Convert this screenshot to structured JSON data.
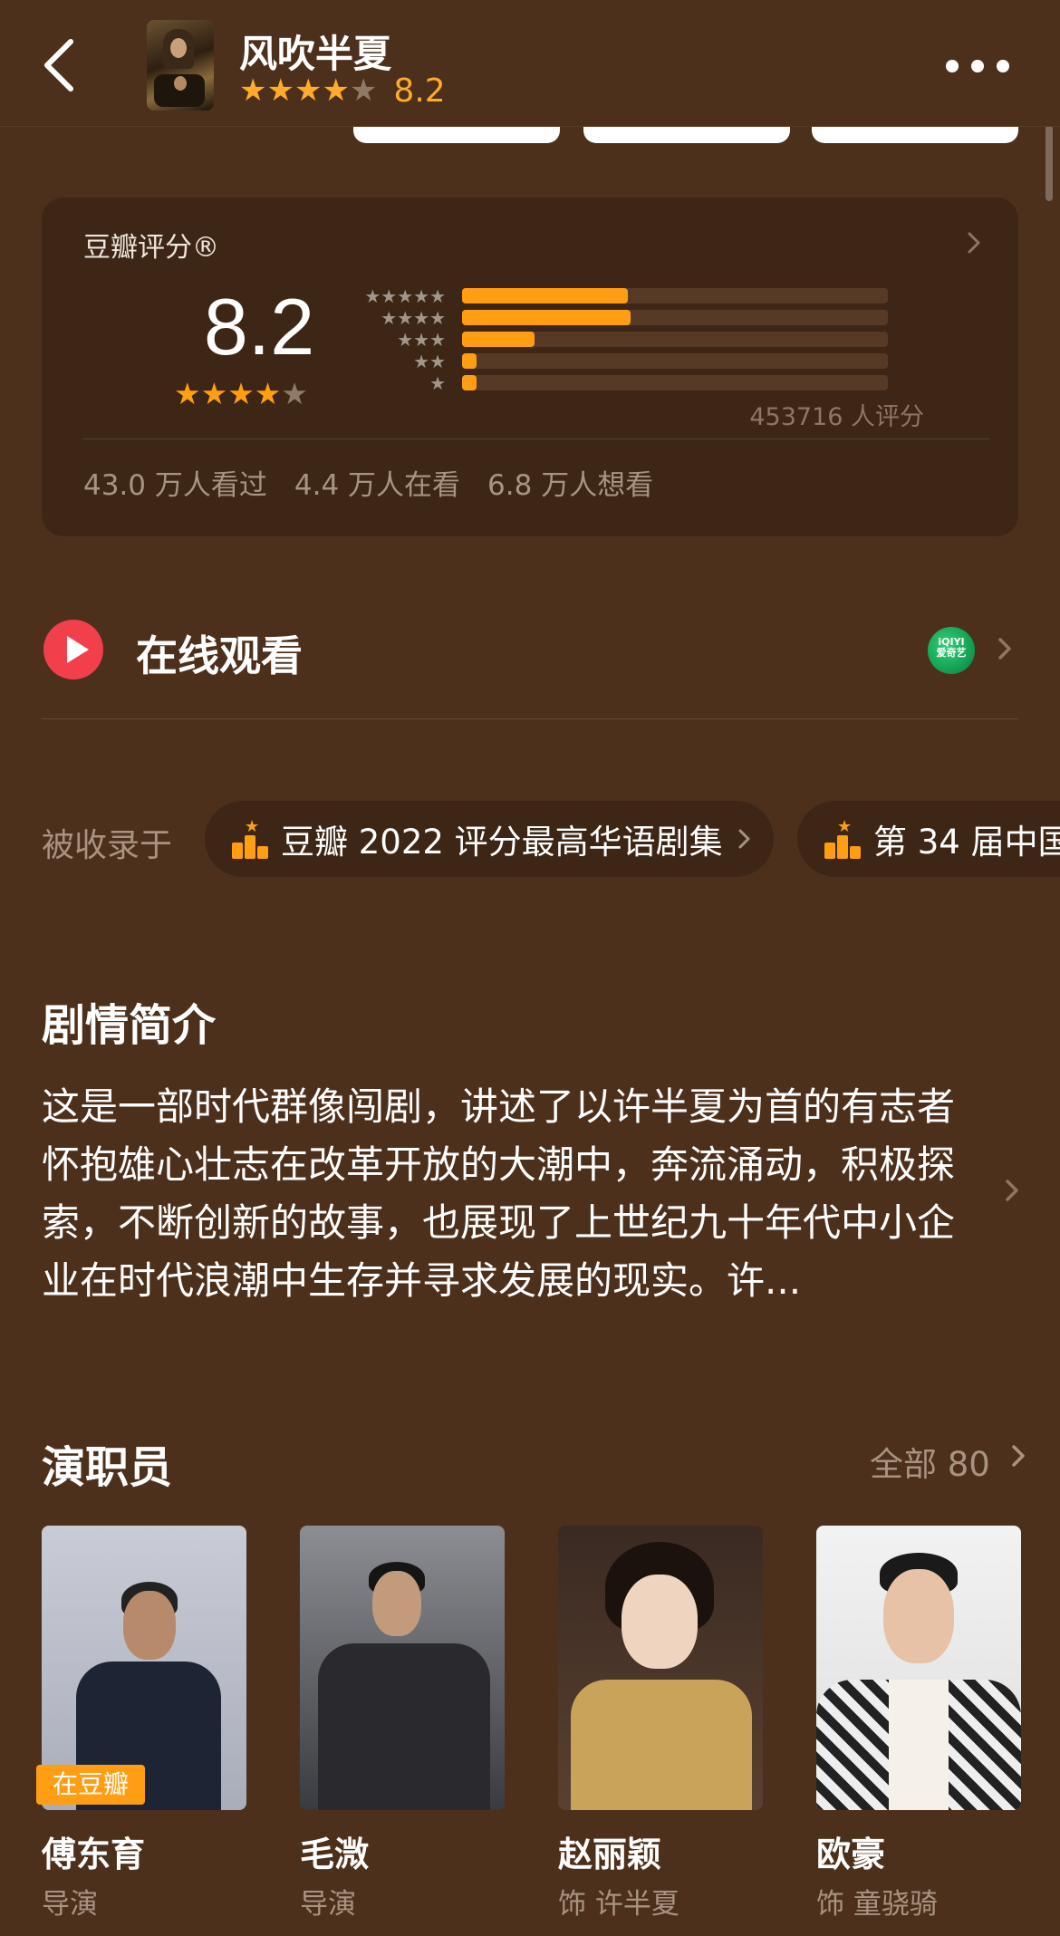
{
  "header": {
    "title": "风吹半夏",
    "score": "8.2",
    "star_rating": 4
  },
  "rating_card": {
    "title": "豆瓣评分®",
    "score": "8.2",
    "star_rating": 4,
    "distribution": [
      {
        "stars": 5,
        "fraction": 0.39
      },
      {
        "stars": 4,
        "fraction": 0.395
      },
      {
        "stars": 3,
        "fraction": 0.17
      },
      {
        "stars": 2,
        "fraction": 0.035
      },
      {
        "stars": 1,
        "fraction": 0.035
      }
    ],
    "count_text": "453716 人评分",
    "stats": [
      "43.0 万人看过",
      "4.4 万人在看",
      "6.8 万人想看"
    ]
  },
  "watch": {
    "label": "在线观看",
    "provider_icon_text": "iQIYI\n爱奇艺",
    "provider_icon": "iqiyi-icon"
  },
  "collections": {
    "label": "被收录于",
    "chips": [
      {
        "text": "豆瓣 2022 评分最高华语剧集"
      },
      {
        "text": "第 34 届中国"
      }
    ]
  },
  "synopsis": {
    "title": "剧情简介",
    "text": "这是一部时代群像闯剧，讲述了以许半夏为首的有志者怀抱雄心壮志在改革开放的大潮中，奔流涌动，积极探索，不断创新的故事，也展现了上世纪九十年代中小企业在时代浪潮中生存并寻求发展的现实。许..."
  },
  "cast": {
    "title": "演职员",
    "all_label": "全部 80",
    "badge": "在豆瓣",
    "members": [
      {
        "name": "傅东育",
        "role": "导演"
      },
      {
        "name": "毛溦",
        "role": "导演"
      },
      {
        "name": "赵丽颖",
        "role": "饰 许半夏"
      },
      {
        "name": "欧豪",
        "role": "饰 童骁骑"
      }
    ]
  },
  "colors": {
    "background": "#4d301c",
    "card": "#3d2615",
    "accent": "#ff9e13",
    "play": "#f1404b",
    "muted_text": "#a89382"
  }
}
